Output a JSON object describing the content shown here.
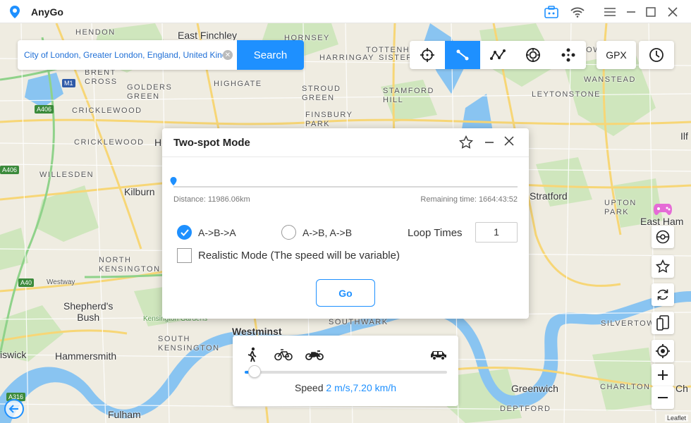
{
  "app": {
    "title": "AnyGo"
  },
  "search": {
    "value": "City of London, Greater London, England, United Kingdom",
    "button": "Search"
  },
  "toolbar": {
    "gpx": "GPX"
  },
  "dialog": {
    "title": "Two-spot Mode",
    "distance": "Distance: 11986.06km",
    "remaining": "Remaining time: 1664:43:52",
    "progress": 0,
    "option_a": "A->B->A",
    "option_b": "A->B, A->B",
    "selected": "A->B->A",
    "loop_label": "Loop Times",
    "loop_value": "1",
    "realistic": "Realistic Mode (The speed will be variable)",
    "realistic_checked": false,
    "go": "Go"
  },
  "speed": {
    "label": "Speed",
    "value": "2 m/s,7.20 km/h",
    "level": 0.05
  },
  "map": {
    "attribution": "Leaflet",
    "labels": {
      "hendon": "HENDON",
      "east_finchley": "East Finchley",
      "hornsey": "HORNSEY",
      "harringay": "HARRINGAY",
      "tottenham": "TOTTENHAM",
      "sisters": "SISTERS",
      "walthamstow": "WALTHAMSTOW",
      "brent_cross": "BRENT\nCROSS",
      "golders_green": "GOLDERS\nGREEN",
      "highgate": "HIGHGATE",
      "stroud_green": "STROUD\nGREEN",
      "stamford_hill": "STAMFORD\nHILL",
      "leytonstone": "LEYTONSTONE",
      "wanstead": "WANSTEAD",
      "cricklewood_1": "CRICKLEWOOD",
      "finsbury_park": "FINSBURY\nPARK",
      "cricklewood_2": "CRICKLEWOOD",
      "willesden": "WILLESDEN",
      "kilburn": "Kilburn",
      "stratford": "Stratford",
      "upton_park": "UPTON\nPARK",
      "east_ham": "East Ham",
      "north_kensington": "NORTH\nKENSINGTON",
      "westway": "Westway",
      "shepherds_bush": "Shepherd's\nBush",
      "kensington_gardens": "Kensington Gardens",
      "south_kensington": "SOUTH\nKENSINGTON",
      "southwark": "SOUTHWARK",
      "hammersmith": "Hammersmith",
      "silvertown": "SILVERTOWN",
      "charlton": "CHARLTON",
      "greenwich": "Greenwich",
      "deptford": "DEPTFORD",
      "fulham": "Fulham",
      "chiswick": "iswick",
      "ilf": "Ilf",
      "ch": "Ch",
      "h_part": "H",
      "westminster": "Westminst"
    },
    "roads": {
      "m1": "M1",
      "a406_1": "A406",
      "a406_2": "A406",
      "a40": "A40",
      "a316": "A316"
    }
  }
}
